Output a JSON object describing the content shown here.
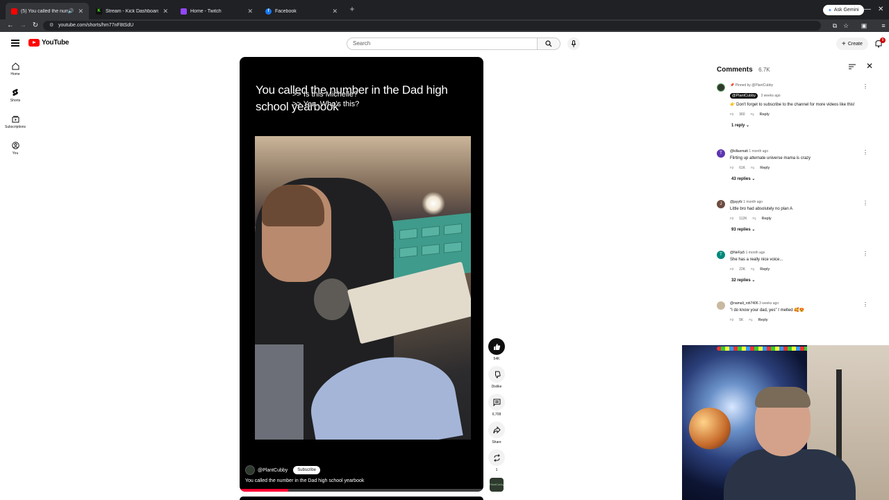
{
  "browser": {
    "tabs": [
      {
        "title": "(5) You called the number",
        "favicon_color": "#ff0000",
        "active": true
      },
      {
        "title": "Stream - Kick Dashboard",
        "favicon_color": "#53fc18",
        "active": false
      },
      {
        "title": "Home - Twitch",
        "favicon_color": "#9146ff",
        "active": false
      },
      {
        "title": "Facebook",
        "favicon_color": "#1877f2",
        "active": false
      }
    ],
    "new_tab": "+",
    "ask_gemini": "Ask Gemini",
    "url": "youtube.com/shorts/hm77nF8tSdU"
  },
  "masthead": {
    "logo_text": "YouTube",
    "search_placeholder": "Search",
    "create_label": "Create",
    "notifications_count": "9"
  },
  "guide": [
    {
      "label": "Home",
      "icon": "home-icon"
    },
    {
      "label": "Shorts",
      "icon": "shorts-icon"
    },
    {
      "label": "Subscriptions",
      "icon": "subscriptions-icon"
    },
    {
      "label": "You",
      "icon": "you-icon"
    }
  ],
  "video": {
    "overlay_title": "You called the number in the Dad high school yearbook",
    "caption_line1": ">> Is this Michelle?",
    "caption_line2": ">> Yes. Who's this?",
    "channel": "@PlantCubby",
    "subscribe_label": "Subscribe",
    "title": "You called the number in the Dad high school yearbook",
    "progress": 0.2
  },
  "actions": {
    "like_count": "54K",
    "dislike_label": "Dislike",
    "comments_count": "6,708",
    "share_label": "Share",
    "remix_count": "1"
  },
  "comments": {
    "title": "Comments",
    "count": "6.7K",
    "items": [
      {
        "pinned_by": "Pinned by @PlantCubby",
        "author": "@PlantCubby",
        "time": "3 weeks ago",
        "text": "👉 Don't forget to subscribe to the channel for more videos like this!",
        "likes": "360",
        "reply_label": "Reply",
        "replies": "1 reply",
        "avatar_color": "#2f3a2f",
        "avatar_letter": ""
      },
      {
        "author": "@killaxmatt",
        "time": "1 month ago",
        "text": "Flirting up alternate universe mama is crazy",
        "likes": "61K",
        "reply_label": "Reply",
        "replies": "43 replies",
        "avatar_color": "#5e35b1",
        "avatar_letter": "T"
      },
      {
        "author": "@jayyfz",
        "time": "1 month ago",
        "text": "Little bro had absolutely no plan A",
        "likes": "112K",
        "reply_label": "Reply",
        "replies": "93 replies",
        "avatar_color": "#6d4c41",
        "avatar_letter": "J"
      },
      {
        "author": "@NeFju5",
        "time": "1 month ago",
        "text": "She has a really nice voice...",
        "likes": "22K",
        "reply_label": "Reply",
        "replies": "32 replies",
        "avatar_color": "#00897b",
        "avatar_letter": "T"
      },
      {
        "author": "@namali_roti7406",
        "time": "3 weeks ago",
        "text": "\"I do know your dad, yes\" I melted 🥰😍",
        "likes": "5K",
        "reply_label": "Reply",
        "replies": "",
        "avatar_color": "#c9b9a0",
        "avatar_letter": ""
      }
    ]
  }
}
